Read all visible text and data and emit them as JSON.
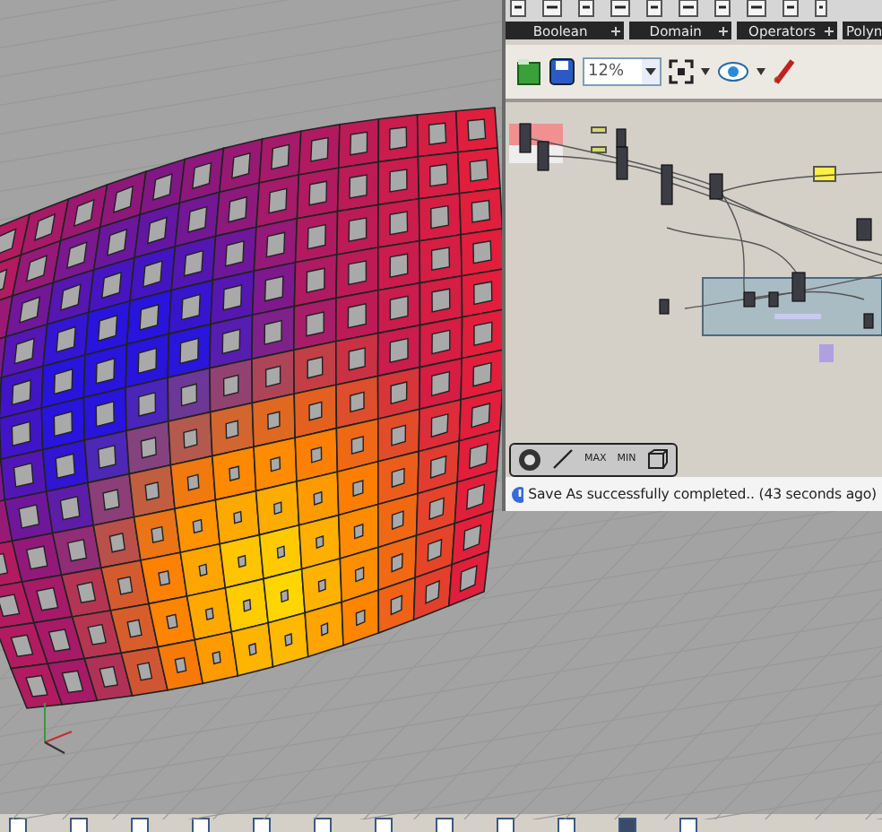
{
  "ribbon": {
    "groups": [
      {
        "label": "Boolean"
      },
      {
        "label": "Domain"
      },
      {
        "label": "Operators"
      },
      {
        "label": "Polyn"
      }
    ]
  },
  "toolbar": {
    "zoom": "12%"
  },
  "widgets": [
    "MAX",
    "MIN"
  ],
  "status": {
    "message": "Save As successfully completed.. (43 seconds ago)"
  },
  "status_bar": {
    "checkboxes": [
      {
        "checked": false
      },
      {
        "checked": false
      },
      {
        "checked": false
      },
      {
        "checked": false
      },
      {
        "checked": false
      },
      {
        "checked": false
      },
      {
        "checked": false
      },
      {
        "checked": false
      },
      {
        "checked": false
      },
      {
        "checked": false
      },
      {
        "checked": true
      },
      {
        "checked": false
      }
    ]
  }
}
